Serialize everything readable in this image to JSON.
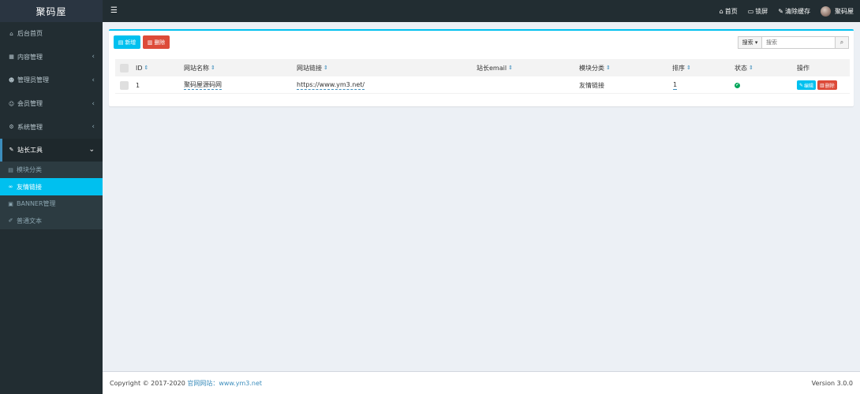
{
  "brand": "聚码屋",
  "sidebar": {
    "items": [
      {
        "label": "后台首页",
        "icon": "home-icon",
        "glyph": "⌂"
      },
      {
        "label": "内容管理",
        "icon": "grid-icon",
        "glyph": "▦"
      },
      {
        "label": "管理员管理",
        "icon": "users-icon",
        "glyph": "☻"
      },
      {
        "label": "会员管理",
        "icon": "user-icon",
        "glyph": "☺"
      },
      {
        "label": "系统管理",
        "icon": "gear-icon",
        "glyph": "⚙"
      },
      {
        "label": "站长工具",
        "icon": "wrench-icon",
        "glyph": "✎"
      }
    ],
    "submenu": [
      {
        "label": "模块分类",
        "icon": "module-icon",
        "glyph": "▤"
      },
      {
        "label": "友情链接",
        "icon": "link-icon",
        "glyph": "∞"
      },
      {
        "label": "BANNER管理",
        "icon": "image-icon",
        "glyph": "▣"
      },
      {
        "label": "普通文本",
        "icon": "pencil-icon",
        "glyph": "✐"
      }
    ]
  },
  "header": {
    "nav": [
      {
        "label": "首页",
        "icon": "home-icon",
        "glyph": "⌂"
      },
      {
        "label": "锁屏",
        "icon": "monitor-icon",
        "glyph": "▭"
      },
      {
        "label": "清除缓存",
        "icon": "brush-icon",
        "glyph": "✎"
      }
    ],
    "username": "聚码屋"
  },
  "toolbar": {
    "add_label": "新增",
    "delete_label": "删除",
    "search_button": "搜索 ▾",
    "search_placeholder": "搜索"
  },
  "table": {
    "columns": [
      "ID",
      "网站名称",
      "网站链接",
      "站长email",
      "模块分类",
      "排序",
      "状态",
      "操作"
    ],
    "rows": [
      {
        "id": "1",
        "name": "聚码屋源码网",
        "url": "https://www.ym3.net/",
        "email": "",
        "category": "友情链接",
        "sort": "1",
        "status": "enabled"
      }
    ],
    "row_edit": "编辑",
    "row_delete": "删除"
  },
  "footer": {
    "copyright": "Copyright © 2017-2020 ",
    "site_label": "官网网站：www.ym3.net",
    "version": "Version 3.0.0"
  },
  "colors": {
    "sidebar_bg": "#222d32",
    "accent": "#00c0ef",
    "danger": "#dd4b39",
    "success": "#00a65a",
    "link": "#3c8dbc"
  }
}
